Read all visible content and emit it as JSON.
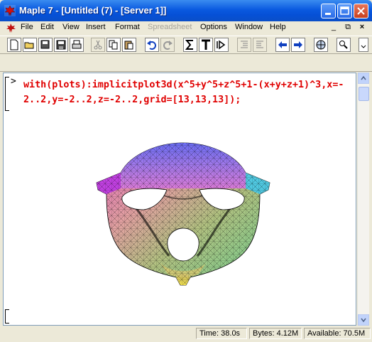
{
  "window": {
    "title": "Maple 7  - [Untitled (7) - [Server 1]]"
  },
  "menu": [
    "File",
    "Edit",
    "View",
    "Insert",
    "Format",
    "Spreadsheet",
    "Options",
    "Window",
    "Help"
  ],
  "menu_disabled": [
    "Spreadsheet"
  ],
  "worksheet": {
    "prompt": ">",
    "command": "with(plots):implicitplot3d(x^5+y^5+z^5+1-(x+y+z+1)^3,x=-2..2,y=-2..2,z=-2..2,grid=[13,13,13]);"
  },
  "status": {
    "time": "Time:  38.0s",
    "bytes": "Bytes: 4.12M",
    "available": "Available: 70.5M"
  },
  "colors": {
    "input_text": "#e00000",
    "titlebar": "#0a5ae0"
  },
  "icons": [
    "new-icon",
    "open-icon",
    "save-icon",
    "save-all-icon",
    "print-icon",
    "cut-icon",
    "copy-icon",
    "paste-icon",
    "undo-icon",
    "redo-icon",
    "sigma-icon",
    "text-icon",
    "execute-icon",
    "indent-icon",
    "outdent-icon",
    "back-icon",
    "forward-icon",
    "stop-icon",
    "zoom-icon"
  ]
}
